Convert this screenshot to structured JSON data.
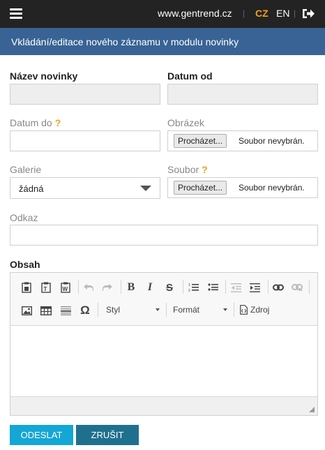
{
  "header": {
    "site": "www.gentrend.cz",
    "separator": "|",
    "lang_cz": "CZ",
    "lang_en": "EN",
    "menu_icon": "hamburger-menu-icon",
    "logout_icon": "logout-icon"
  },
  "page": {
    "title": "Vkládání/editace nového záznamu v modulu novinky"
  },
  "form": {
    "name_label": "Název novinky",
    "date_from_label": "Datum od",
    "date_to_label": "Datum do",
    "image_label": "Obrázek",
    "gallery_label": "Galerie",
    "gallery_value": "žádná",
    "file_label": "Soubor",
    "link_label": "Odkaz",
    "content_label": "Obsah",
    "help_mark": "?",
    "browse_label": "Procházet...",
    "no_file_label": "Soubor nevybrán."
  },
  "editor": {
    "style_label": "Styl",
    "format_label": "Formát",
    "source_label": "Zdroj",
    "icons": [
      "paste-icon",
      "paste-text-icon",
      "paste-word-icon",
      "undo-icon",
      "redo-icon",
      "bold-icon",
      "italic-icon",
      "strikethrough-icon",
      "numbered-list-icon",
      "bullet-list-icon",
      "outdent-icon",
      "indent-icon",
      "link-icon",
      "unlink-icon",
      "image-icon",
      "table-icon",
      "horizontal-line-icon",
      "special-char-icon",
      "source-icon"
    ]
  },
  "buttons": {
    "submit": "ODESLAT",
    "cancel": "ZRUŠIT"
  },
  "colors": {
    "topbar": "#232323",
    "titlebar": "#386394",
    "accent": "#f0a020",
    "submit": "#14a6d5",
    "cancel": "#1f708e"
  }
}
